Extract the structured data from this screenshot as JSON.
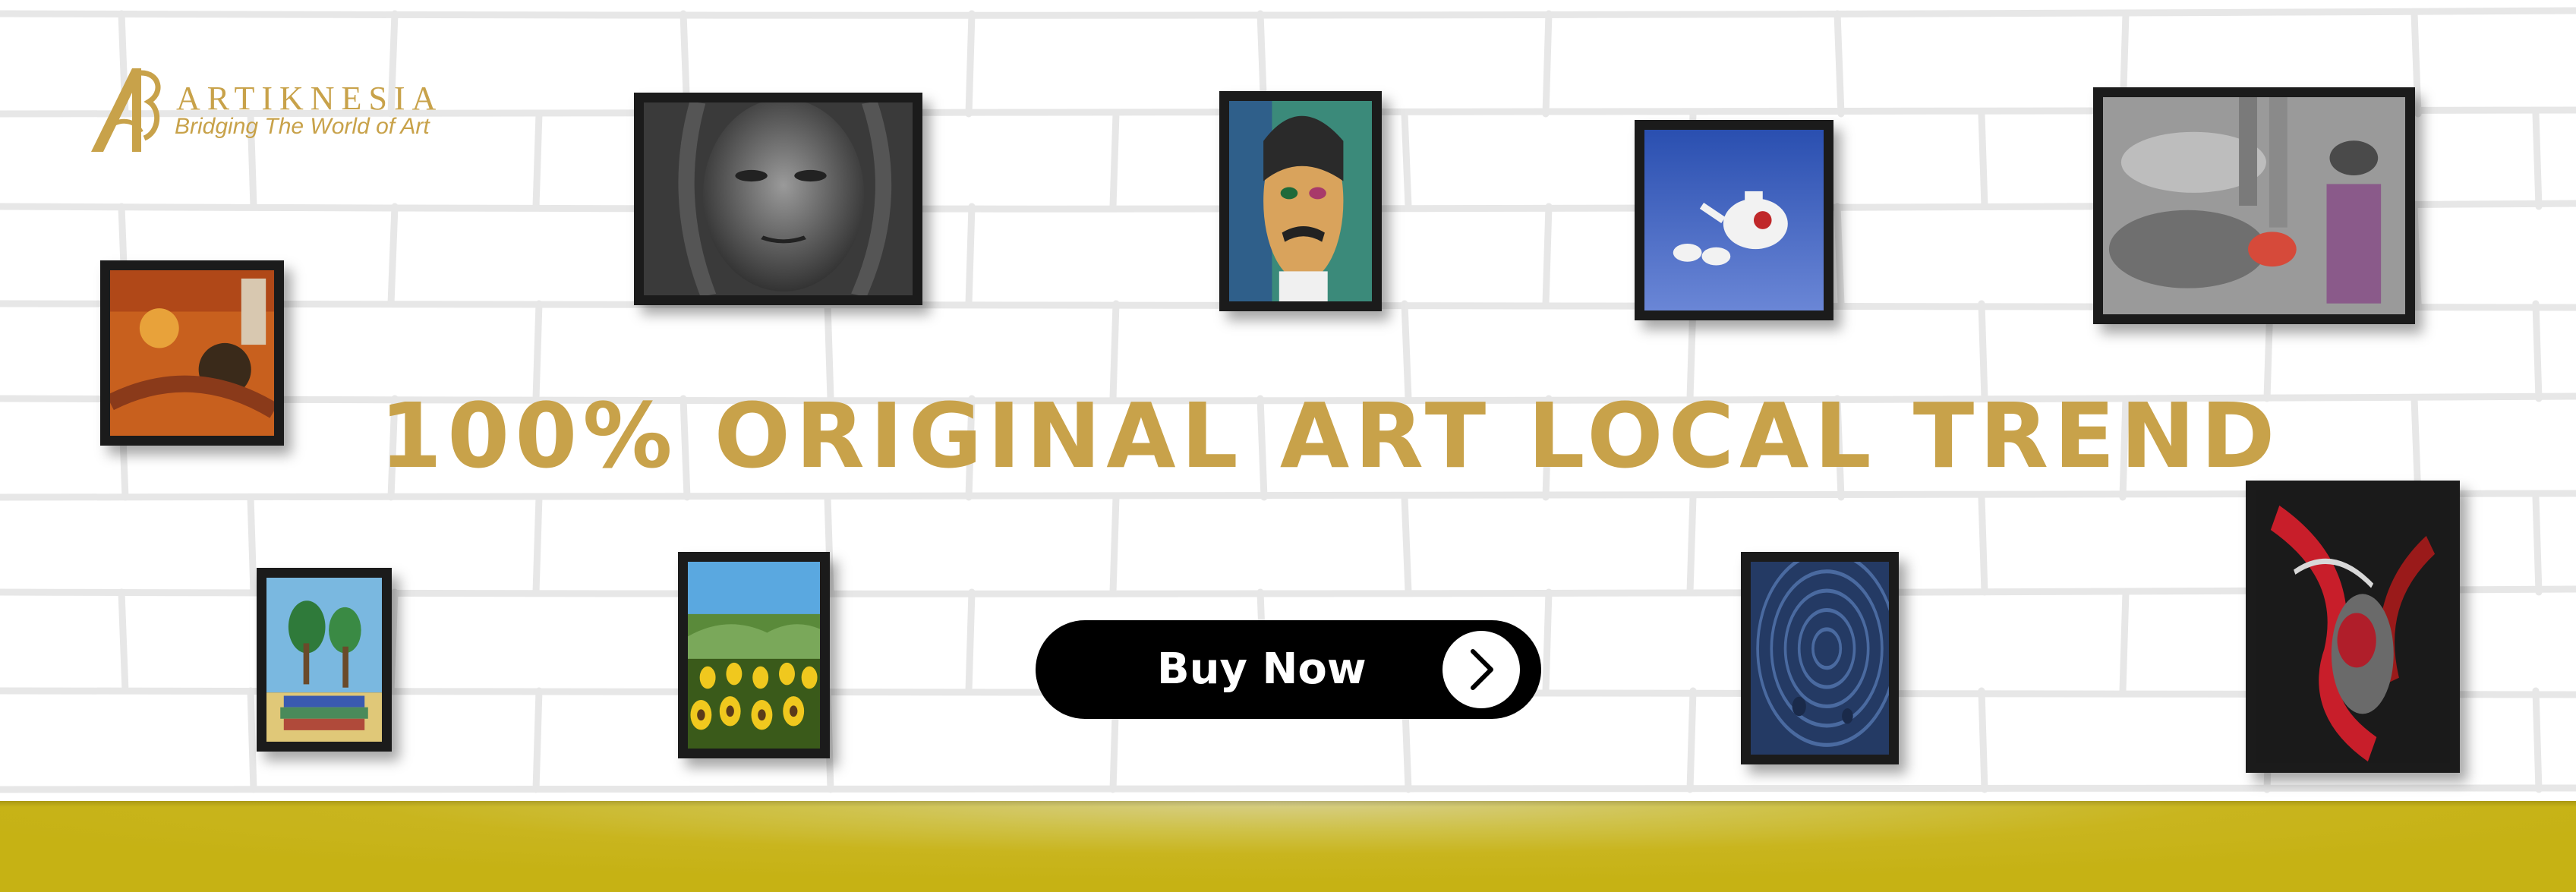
{
  "brand": {
    "name": "ARTIKNESIA",
    "tagline": "Bridging The World of Art",
    "color": "#c8a24a"
  },
  "headline": "100% ORIGINAL ART LOCAL TREND",
  "cta": {
    "label": "Buy Now",
    "icon": "chevron-right-icon"
  },
  "colors": {
    "gold": "#c8a24a",
    "button": "#000000",
    "floor": "#c9b51e"
  }
}
